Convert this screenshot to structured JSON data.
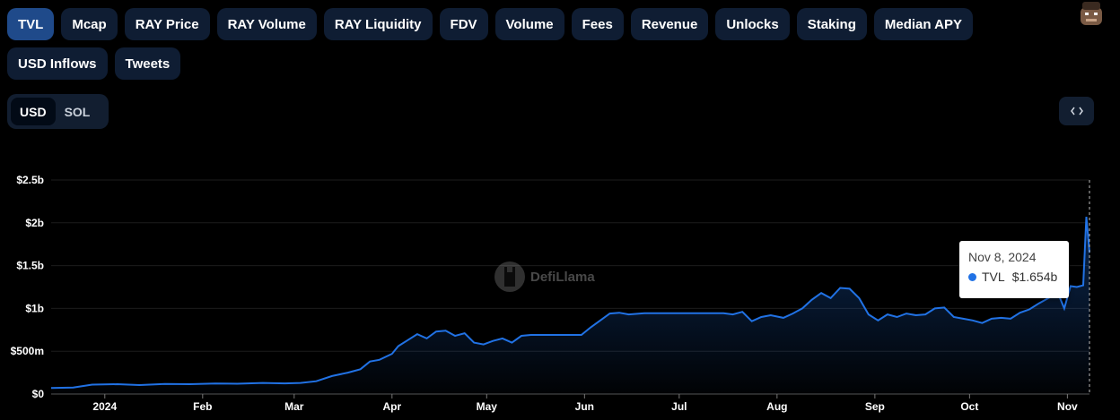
{
  "tabs": [
    {
      "label": "TVL",
      "active": true
    },
    {
      "label": "Mcap"
    },
    {
      "label": "RAY Price"
    },
    {
      "label": "RAY Volume"
    },
    {
      "label": "RAY Liquidity"
    },
    {
      "label": "FDV"
    },
    {
      "label": "Volume"
    },
    {
      "label": "Fees"
    },
    {
      "label": "Revenue"
    },
    {
      "label": "Unlocks"
    },
    {
      "label": "Staking"
    },
    {
      "label": "Median APY"
    },
    {
      "label": "USD Inflows"
    },
    {
      "label": "Tweets"
    }
  ],
  "currency_toggle": {
    "options": [
      "USD",
      "SOL"
    ],
    "selected": "USD"
  },
  "embed_icon": "code-brackets-icon",
  "watermark": {
    "text": "DefiLlama"
  },
  "tooltip": {
    "date": "Nov 8, 2024",
    "series": "TVL",
    "value": "$1.654b",
    "dot_color": "#2172e5"
  },
  "colors": {
    "line": "#2172e5",
    "accent_tab": "#1f4a8a"
  },
  "chart_data": {
    "type": "area",
    "y_ticks": [
      "$0",
      "$500m",
      "$1b",
      "$1.5b",
      "$2b",
      "$2.5b"
    ],
    "y_tick_values": [
      0,
      500,
      1000,
      1500,
      2000,
      2500
    ],
    "x_ticks": [
      "2024",
      "Feb",
      "Mar",
      "Apr",
      "May",
      "Jun",
      "Jul",
      "Aug",
      "Sep",
      "Oct",
      "Nov"
    ],
    "x_tick_dates": [
      "2024-01-01",
      "2024-02-01",
      "2024-03-01",
      "2024-04-01",
      "2024-05-01",
      "2024-06-01",
      "2024-07-01",
      "2024-08-01",
      "2024-09-01",
      "2024-10-01",
      "2024-11-01"
    ],
    "xlim": [
      "2023-12-15",
      "2024-11-08"
    ],
    "ylim": [
      0,
      2500
    ],
    "y_unit": "USD millions",
    "grid": true,
    "series": [
      {
        "values": [
          [
            "2023-12-15",
            70
          ],
          [
            "2023-12-22",
            75
          ],
          [
            "2023-12-28",
            110
          ],
          [
            "2024-01-05",
            115
          ],
          [
            "2024-01-12",
            105
          ],
          [
            "2024-01-20",
            118
          ],
          [
            "2024-01-28",
            115
          ],
          [
            "2024-02-05",
            122
          ],
          [
            "2024-02-12",
            120
          ],
          [
            "2024-02-20",
            130
          ],
          [
            "2024-02-27",
            125
          ],
          [
            "2024-03-03",
            130
          ],
          [
            "2024-03-08",
            150
          ],
          [
            "2024-03-13",
            210
          ],
          [
            "2024-03-18",
            250
          ],
          [
            "2024-03-22",
            290
          ],
          [
            "2024-03-25",
            380
          ],
          [
            "2024-03-28",
            400
          ],
          [
            "2024-04-01",
            470
          ],
          [
            "2024-04-03",
            560
          ],
          [
            "2024-04-06",
            630
          ],
          [
            "2024-04-09",
            700
          ],
          [
            "2024-04-12",
            650
          ],
          [
            "2024-04-15",
            730
          ],
          [
            "2024-04-18",
            740
          ],
          [
            "2024-04-21",
            680
          ],
          [
            "2024-04-24",
            710
          ],
          [
            "2024-04-27",
            600
          ],
          [
            "2024-04-30",
            580
          ],
          [
            "2024-05-03",
            620
          ],
          [
            "2024-05-06",
            650
          ],
          [
            "2024-05-09",
            600
          ],
          [
            "2024-05-12",
            680
          ],
          [
            "2024-05-15",
            690
          ],
          [
            "2024-05-20",
            690
          ],
          [
            "2024-05-25",
            690
          ],
          [
            "2024-05-31",
            690
          ],
          [
            "2024-06-03",
            780
          ],
          [
            "2024-06-06",
            860
          ],
          [
            "2024-06-09",
            940
          ],
          [
            "2024-06-12",
            950
          ],
          [
            "2024-06-15",
            930
          ],
          [
            "2024-06-20",
            945
          ],
          [
            "2024-07-01",
            945
          ],
          [
            "2024-07-10",
            945
          ],
          [
            "2024-07-15",
            945
          ],
          [
            "2024-07-18",
            930
          ],
          [
            "2024-07-21",
            960
          ],
          [
            "2024-07-24",
            850
          ],
          [
            "2024-07-27",
            900
          ],
          [
            "2024-07-30",
            920
          ],
          [
            "2024-08-03",
            890
          ],
          [
            "2024-08-06",
            940
          ],
          [
            "2024-08-09",
            1000
          ],
          [
            "2024-08-12",
            1100
          ],
          [
            "2024-08-15",
            1180
          ],
          [
            "2024-08-18",
            1120
          ],
          [
            "2024-08-21",
            1240
          ],
          [
            "2024-08-24",
            1230
          ],
          [
            "2024-08-27",
            1120
          ],
          [
            "2024-08-30",
            930
          ],
          [
            "2024-09-02",
            860
          ],
          [
            "2024-09-05",
            930
          ],
          [
            "2024-09-08",
            900
          ],
          [
            "2024-09-11",
            940
          ],
          [
            "2024-09-14",
            920
          ],
          [
            "2024-09-17",
            930
          ],
          [
            "2024-09-20",
            1000
          ],
          [
            "2024-09-23",
            1010
          ],
          [
            "2024-09-26",
            900
          ],
          [
            "2024-09-29",
            880
          ],
          [
            "2024-10-02",
            860
          ],
          [
            "2024-10-05",
            830
          ],
          [
            "2024-10-08",
            880
          ],
          [
            "2024-10-11",
            890
          ],
          [
            "2024-10-14",
            880
          ],
          [
            "2024-10-17",
            950
          ],
          [
            "2024-10-20",
            990
          ],
          [
            "2024-10-23",
            1060
          ],
          [
            "2024-10-26",
            1120
          ],
          [
            "2024-10-29",
            1180
          ],
          [
            "2024-10-31",
            1000
          ],
          [
            "2024-11-02",
            1260
          ],
          [
            "2024-11-04",
            1250
          ],
          [
            "2024-11-06",
            1270
          ],
          [
            "2024-11-07",
            2070
          ],
          [
            "2024-11-08",
            1654
          ]
        ]
      }
    ]
  }
}
